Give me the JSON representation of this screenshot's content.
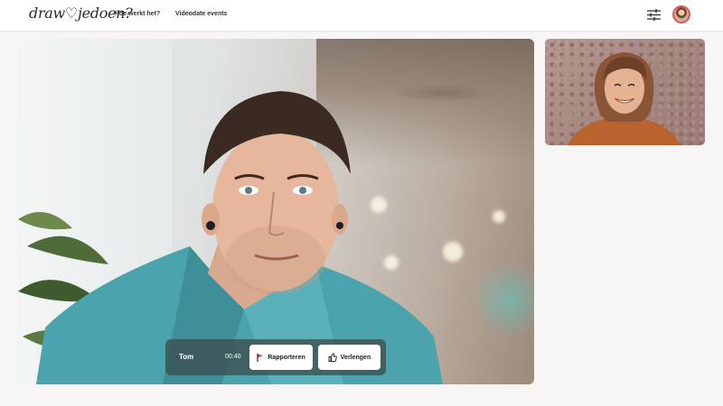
{
  "header": {
    "logo_text": "draw♡jedoen?",
    "nav": [
      {
        "label": "Hoe werkt het?"
      },
      {
        "label": "Videodate events"
      }
    ],
    "icons": {
      "filter": "sliders-icon",
      "avatar": "user-avatar"
    }
  },
  "call": {
    "name": "Tom",
    "timer": "00:40",
    "report_label": "Rapporteren",
    "extend_label": "Verlengen",
    "icons": {
      "report": "flag-icon",
      "extend": "thumbs-up-icon"
    }
  },
  "colors": {
    "accent": "#e05a5a",
    "controls_bg": "#3c4e50",
    "page_bg": "#f7f5f6"
  }
}
